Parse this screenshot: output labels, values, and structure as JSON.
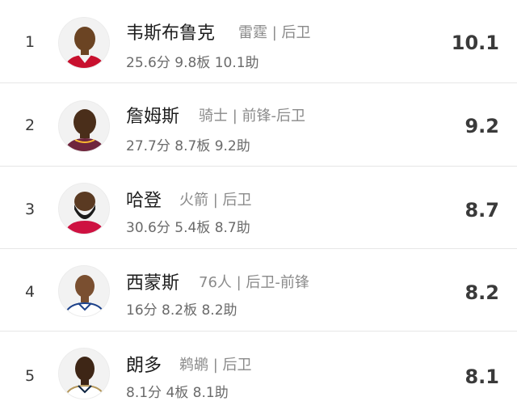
{
  "players": [
    {
      "rank": "1",
      "name": "韦斯布鲁克",
      "team_position": "雷霆 | 后卫",
      "stats": "25.6分 9.8板 10.1助",
      "score": "10.1",
      "jersey_color": "#c8102e"
    },
    {
      "rank": "2",
      "name": "詹姆斯",
      "team_position": "骑士 | 前锋-后卫",
      "stats": "27.7分 8.7板 9.2助",
      "score": "9.2",
      "jersey_color": "#6f263d"
    },
    {
      "rank": "3",
      "name": "哈登",
      "team_position": "火箭 | 后卫",
      "stats": "30.6分 5.4板 8.7助",
      "score": "8.7",
      "jersey_color": "#ce1141"
    },
    {
      "rank": "4",
      "name": "西蒙斯",
      "team_position": "76人 | 后卫-前锋",
      "stats": "16分 8.2板 8.2助",
      "score": "8.2",
      "jersey_color": "#ffffff"
    },
    {
      "rank": "5",
      "name": "朗多",
      "team_position": "鹈鹕 | 后卫",
      "stats": "8.1分 4板 8.1助",
      "score": "8.1",
      "jersey_color": "#ffffff"
    }
  ]
}
